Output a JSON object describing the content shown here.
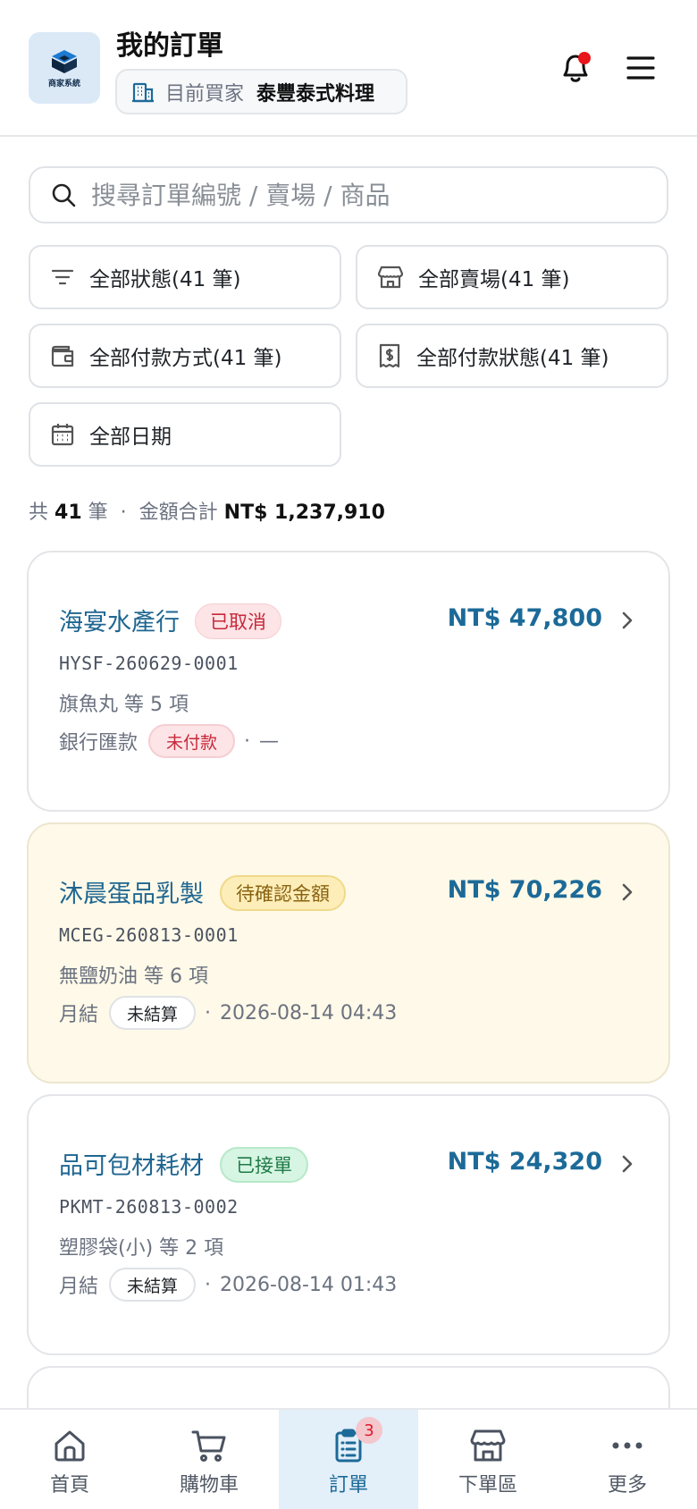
{
  "header": {
    "logo_text": "商家系統",
    "title": "我的訂單",
    "buyer_label": "目前買家",
    "buyer_name": "泰豐泰式料理"
  },
  "search": {
    "placeholder": "搜尋訂單編號 / 賣場 / 商品"
  },
  "filters": [
    {
      "label": "全部狀態(41 筆)",
      "icon": "filter-icon"
    },
    {
      "label": "全部賣場(41 筆)",
      "icon": "store-icon"
    },
    {
      "label": "全部付款方式(41 筆)",
      "icon": "wallet-icon"
    },
    {
      "label": "全部付款狀態(41 筆)",
      "icon": "receipt-icon"
    },
    {
      "label": "全部日期",
      "icon": "calendar-icon"
    }
  ],
  "summary": {
    "prefix": "共",
    "count": "41",
    "unit": "筆",
    "separator": "·",
    "amount_label": "金額合計",
    "amount_value": "NT$ 1,237,910"
  },
  "orders": [
    {
      "vendor": "海宴水產行",
      "status": "已取消",
      "amount": "NT$ 47,800",
      "order_no": "HYSF-260629-0001",
      "items": "旗魚丸 等 5 項",
      "payment_method": "銀行匯款",
      "payment_status": "未付款",
      "separator": "·",
      "time": "—"
    },
    {
      "vendor": "沐晨蛋品乳製",
      "status": "待確認金額",
      "amount": "NT$ 70,226",
      "order_no": "MCEG-260813-0001",
      "items": "無鹽奶油 等 6 項",
      "payment_method": "月結",
      "payment_status": "未結算",
      "separator": "·",
      "time": "2026-08-14 04:43"
    },
    {
      "vendor": "品可包材耗材",
      "status": "已接單",
      "amount": "NT$ 24,320",
      "order_no": "PKMT-260813-0002",
      "items": "塑膠袋(小) 等 2 項",
      "payment_method": "月結",
      "payment_status": "未結算",
      "separator": "·",
      "time": "2026-08-14 01:43"
    }
  ],
  "bottom_nav": [
    {
      "label": "首頁",
      "icon": "home-icon"
    },
    {
      "label": "購物車",
      "icon": "cart-icon"
    },
    {
      "label": "訂單",
      "icon": "orders-icon",
      "badge": "3",
      "active": true
    },
    {
      "label": "下單區",
      "icon": "shop-icon"
    },
    {
      "label": "更多",
      "icon": "more-icon"
    }
  ],
  "colors": {
    "accent": "#1c6a98",
    "notification_dot": "#e8151b",
    "pending_card_bg": "#fef9e8",
    "cancel_badge": "#c7283b",
    "accepted_badge": "#1f7a46"
  }
}
